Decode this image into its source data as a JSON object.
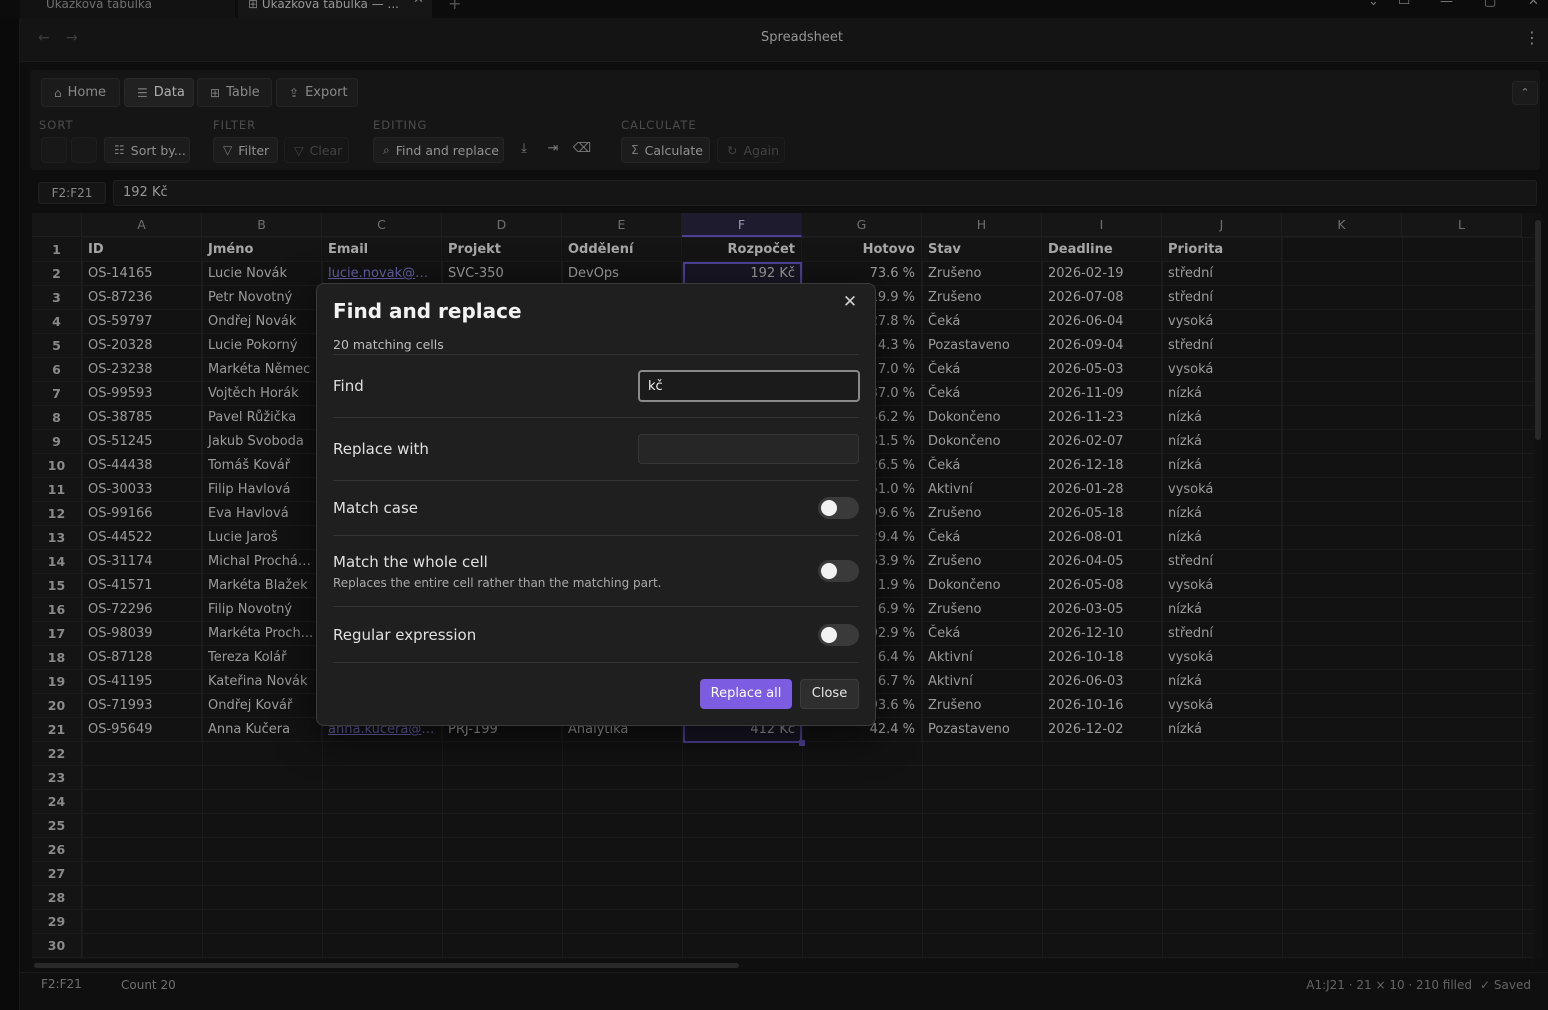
{
  "browser": {
    "tabs": [
      {
        "label": "Ukázková tabulka"
      },
      {
        "label": "Ukázková tabulka — ..."
      }
    ]
  },
  "app": {
    "title": "Spreadsheet"
  },
  "ribbon": {
    "tabs": [
      {
        "label": "Home",
        "icon": "home-icon"
      },
      {
        "label": "Data",
        "icon": "database-icon",
        "active": true
      },
      {
        "label": "Table",
        "icon": "table-icon"
      },
      {
        "label": "Export",
        "icon": "export-icon"
      }
    ],
    "groups": {
      "sort": {
        "label": "SORT",
        "sort_by": "Sort by..."
      },
      "filter": {
        "label": "FILTER",
        "filter": "Filter",
        "clear": "Clear"
      },
      "editing": {
        "label": "EDITING",
        "find_replace": "Find and replace"
      },
      "calculate": {
        "label": "CALCULATE",
        "calculate": "Calculate",
        "again": "Again"
      }
    }
  },
  "formula_bar": {
    "name_box": "F2:F21",
    "value": "192 Kč"
  },
  "grid": {
    "columns": [
      "A",
      "B",
      "C",
      "D",
      "E",
      "F",
      "G",
      "H",
      "I",
      "J",
      "K",
      "L"
    ],
    "selected_column": "F",
    "header_row": [
      "ID",
      "Jméno",
      "Email",
      "Projekt",
      "Oddělení",
      "Rozpočet",
      "Hotovo",
      "Stav",
      "Deadline",
      "Priorita"
    ],
    "rows": [
      [
        "OS-14165",
        "Lucie Novák",
        "lucie.novak@fir...",
        "SVC-350",
        "DevOps",
        "192 Kč",
        "73.6 %",
        "Zrušeno",
        "2026-02-19",
        "střední"
      ],
      [
        "OS-87236",
        "Petr Novotný",
        "",
        "",
        "",
        "",
        "19.9 %",
        "Zrušeno",
        "2026-07-08",
        "střední"
      ],
      [
        "OS-59797",
        "Ondřej Novák",
        "",
        "",
        "",
        "",
        "27.8 %",
        "Čeká",
        "2026-06-04",
        "vysoká"
      ],
      [
        "OS-20328",
        "Lucie Pokorný",
        "",
        "",
        "",
        "",
        "4.3 %",
        "Pozastaveno",
        "2026-09-04",
        "střední"
      ],
      [
        "OS-23238",
        "Markéta Němec",
        "",
        "",
        "",
        "",
        "7.0 %",
        "Čeká",
        "2026-05-03",
        "vysoká"
      ],
      [
        "OS-99593",
        "Vojtěch Horák",
        "",
        "",
        "",
        "",
        "37.0 %",
        "Čeká",
        "2026-11-09",
        "nízká"
      ],
      [
        "OS-38785",
        "Pavel Růžička",
        "",
        "",
        "",
        "",
        "46.2 %",
        "Dokončeno",
        "2026-11-23",
        "nízká"
      ],
      [
        "OS-51245",
        "Jakub Svoboda",
        "",
        "",
        "",
        "",
        "31.5 %",
        "Dokončeno",
        "2026-02-07",
        "nízká"
      ],
      [
        "OS-44438",
        "Tomáš Kovář",
        "",
        "",
        "",
        "",
        "26.5 %",
        "Čeká",
        "2026-12-18",
        "nízká"
      ],
      [
        "OS-30033",
        "Filip Havlová",
        "",
        "",
        "",
        "",
        "51.0 %",
        "Aktivní",
        "2026-01-28",
        "vysoká"
      ],
      [
        "OS-99166",
        "Eva Havlová",
        "",
        "",
        "",
        "",
        "99.6 %",
        "Zrušeno",
        "2026-05-18",
        "nízká"
      ],
      [
        "OS-44522",
        "Lucie Jaroš",
        "",
        "",
        "",
        "",
        "29.4 %",
        "Čeká",
        "2026-08-01",
        "nízká"
      ],
      [
        "OS-31174",
        "Michal Procház...",
        "",
        "",
        "",
        "",
        "63.9 %",
        "Zrušeno",
        "2026-04-05",
        "střední"
      ],
      [
        "OS-41571",
        "Markéta Blažek",
        "",
        "",
        "",
        "",
        "1.9 %",
        "Dokončeno",
        "2026-05-08",
        "vysoká"
      ],
      [
        "OS-72296",
        "Filip Novotný",
        "",
        "",
        "",
        "",
        "6.9 %",
        "Zrušeno",
        "2026-03-05",
        "nízká"
      ],
      [
        "OS-98039",
        "Markéta Proch...",
        "",
        "",
        "",
        "",
        "92.9 %",
        "Čeká",
        "2026-12-10",
        "střední"
      ],
      [
        "OS-87128",
        "Tereza Kolář",
        "",
        "",
        "",
        "",
        "6.4 %",
        "Aktivní",
        "2026-10-18",
        "vysoká"
      ],
      [
        "OS-41195",
        "Kateřina Novák",
        "",
        "",
        "",
        "",
        "6.7 %",
        "Aktivní",
        "2026-06-03",
        "nízká"
      ],
      [
        "OS-71993",
        "Ondřej Kovář",
        "",
        "",
        "",
        "",
        "93.6 %",
        "Zrušeno",
        "2026-10-16",
        "vysoká"
      ],
      [
        "OS-95649",
        "Anna Kučera",
        "anna.kucera@f...",
        "PRJ-199",
        "Analytika",
        "412 Kč",
        "42.4 %",
        "Pozastaveno",
        "2026-12-02",
        "nízká"
      ]
    ],
    "row_numbers": [
      "1",
      "2",
      "3",
      "4",
      "5",
      "6",
      "7",
      "8",
      "9",
      "10",
      "11",
      "12",
      "13",
      "14",
      "15",
      "16",
      "17",
      "18",
      "19",
      "20",
      "21",
      "22",
      "23",
      "24",
      "25",
      "26",
      "27",
      "28",
      "29",
      "30"
    ]
  },
  "status_bar": {
    "range": "F2:F21",
    "count": "Count 20",
    "info": "A1:J21 · 21 × 10 · 210 filled",
    "saved": "Saved"
  },
  "dialog": {
    "title": "Find and replace",
    "match_count": "20 matching cells",
    "find_label": "Find",
    "find_value": "kč",
    "replace_label": "Replace with",
    "replace_value": "",
    "match_case_label": "Match case",
    "match_case": false,
    "whole_cell_label": "Match the whole cell",
    "whole_cell_desc": "Replaces the entire cell rather than the matching part.",
    "whole_cell": false,
    "regex_label": "Regular expression",
    "regex": false,
    "replace_all_label": "Replace all",
    "close_label": "Close"
  },
  "colors": {
    "accent": "#7c5ce0",
    "selection": "#6a5ad0",
    "link": "#8f87e6"
  }
}
